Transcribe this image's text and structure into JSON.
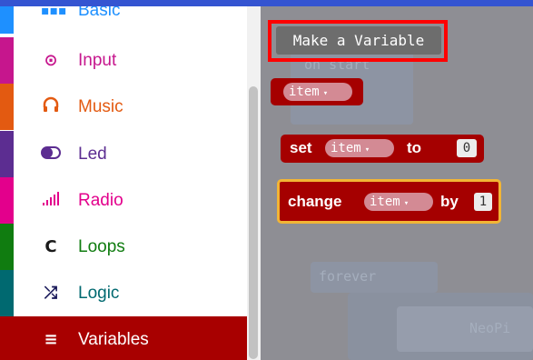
{
  "toolbox": {
    "categories": [
      {
        "label": "Basic",
        "icon": "basic-grid-icon",
        "color": "#1e90ff"
      },
      {
        "label": "Input",
        "icon": "radio-target-icon",
        "color": "#c6168d"
      },
      {
        "label": "Music",
        "icon": "headphones-icon",
        "color": "#e35a11"
      },
      {
        "label": "Led",
        "icon": "toggle-icon",
        "color": "#5c2d91"
      },
      {
        "label": "Radio",
        "icon": "signal-bars-icon",
        "color": "#e3008c"
      },
      {
        "label": "Loops",
        "icon": "loop-arrow-icon",
        "color": "#107c10"
      },
      {
        "label": "Logic",
        "icon": "shuffle-icon",
        "color": "#006970"
      },
      {
        "label": "Variables",
        "icon": "list-lines-icon",
        "color": "#a80000",
        "selected": true
      }
    ]
  },
  "flyout": {
    "make_variable_label": "Make a Variable",
    "var_block_label": "item",
    "set_block": {
      "keyword_set": "set",
      "variable": "item",
      "keyword_to": "to",
      "value": "0"
    },
    "change_block": {
      "keyword_change": "change",
      "variable": "item",
      "keyword_by": "by",
      "value": "1"
    }
  },
  "background": {
    "on_start_label": "on start",
    "forever_label": "forever",
    "neopixel_label": "NeoPi"
  }
}
